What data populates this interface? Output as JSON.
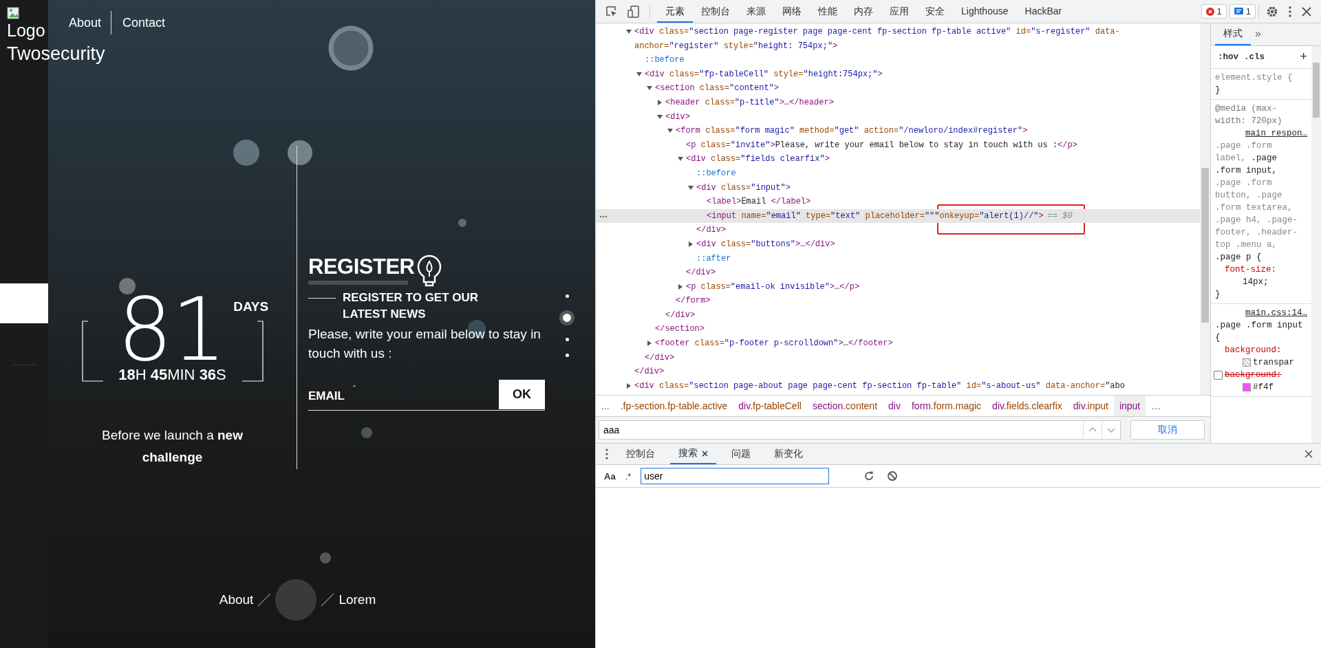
{
  "page": {
    "logo_alt": "Logo",
    "brand": "Twosecurity",
    "nav": [
      {
        "label": "About"
      },
      {
        "label": "Contact"
      }
    ],
    "countdown": {
      "days": "81",
      "days_label": "DAYS",
      "parts": [
        {
          "value": "18",
          "unit": "H"
        },
        {
          "value": "45",
          "unit": "MIN"
        },
        {
          "value": "36",
          "unit": "S"
        }
      ]
    },
    "tagline": "Before we launch a **new challenge**",
    "register": {
      "title": "REGISTER",
      "subtitle": "REGISTER TO GET OUR LATEST NEWS",
      "invite": "Please, write your email below to stay in touch with us :",
      "email_label": "EMAIL",
      "email_value": "\"",
      "button": "OK"
    },
    "section_dots": [
      {
        "selected": false
      },
      {
        "selected": true
      },
      {
        "selected": false
      },
      {
        "selected": false
      }
    ],
    "footer_links": [
      {
        "label": "About"
      },
      {
        "label": "Lorem"
      }
    ]
  },
  "devtools": {
    "tabs": [
      {
        "label": "元素",
        "selected": true
      },
      {
        "label": "控制台",
        "selected": false
      },
      {
        "label": "来源",
        "selected": false
      },
      {
        "label": "网络",
        "selected": false
      },
      {
        "label": "性能",
        "selected": false
      },
      {
        "label": "内存",
        "selected": false
      },
      {
        "label": "应用",
        "selected": false
      },
      {
        "label": "安全",
        "selected": false
      },
      {
        "label": "Lighthouse",
        "selected": false
      },
      {
        "label": "HackBar",
        "selected": false
      }
    ],
    "errors": "1",
    "messages": "1",
    "tree": [
      {
        "kind": "parent",
        "expanded": true,
        "selected": false,
        "text": "<div class=\"section page-register page page-cent fp-section fp-table active\" id=\"s-register\" data-anchor=\"register\" style=\"height: 754px;\">",
        "close": "</div>",
        "children": [
          {
            "kind": "pseudo",
            "selected": false,
            "text": "::before"
          },
          {
            "kind": "parent",
            "expanded": true,
            "selected": false,
            "text": "<div class=\"fp-tableCell\" style=\"height:754px;\">",
            "close": "</div>",
            "children": [
              {
                "kind": "parent",
                "expanded": true,
                "selected": false,
                "text": "<section class=\"content\">",
                "close": "</section>",
                "children": [
                  {
                    "kind": "parent",
                    "expanded": false,
                    "selected": false,
                    "text": "<header class=\"p-title\">…</header>"
                  },
                  {
                    "kind": "parent",
                    "expanded": true,
                    "selected": false,
                    "text": "<div>",
                    "close": "</div>",
                    "children": [
                      {
                        "kind": "parent",
                        "expanded": true,
                        "selected": false,
                        "text": "<form class=\"form magic\" method=\"get\" action=\"/newloro/index#register\">",
                        "close": "</form>",
                        "children": [
                          {
                            "kind": "leaf",
                            "selected": false,
                            "text": "<p class=\"invite\">Please, write your email below to stay in touch with us :</p>"
                          },
                          {
                            "kind": "parent",
                            "expanded": true,
                            "selected": false,
                            "text": "<div class=\"fields clearfix\">",
                            "close": "</div>",
                            "children": [
                              {
                                "kind": "pseudo",
                                "selected": false,
                                "text": "::before"
                              },
                              {
                                "kind": "parent",
                                "expanded": true,
                                "selected": false,
                                "text": "<div class=\"input\">",
                                "close": "</div>",
                                "children": [
                                  {
                                    "kind": "leaf",
                                    "selected": false,
                                    "text": "<label>Email </label>"
                                  },
                                  {
                                    "kind": "leaf",
                                    "selected": true,
                                    "text": "<input name=\"email\" type=\"text\" placeholder=\"\"\"",
                                    "annotation": "onkeyup=\"alert(1)//\">",
                                    "suffix": "== $0"
                                  }
                                ]
                              },
                              {
                                "kind": "parent",
                                "expanded": false,
                                "selected": false,
                                "text": "<div class=\"buttons\">…</div>"
                              },
                              {
                                "kind": "pseudo",
                                "selected": false,
                                "text": "::after"
                              }
                            ]
                          },
                          {
                            "kind": "parent",
                            "expanded": false,
                            "selected": false,
                            "text": "<p class=\"email-ok invisible\">…</p>"
                          }
                        ]
                      }
                    ]
                  }
                ]
              },
              {
                "kind": "parent",
                "expanded": false,
                "selected": false,
                "text": "<footer class=\"p-footer p-scrolldown\">…</footer>"
              }
            ]
          }
        ]
      },
      {
        "kind": "parent",
        "expanded": false,
        "selected": false,
        "text": "<div class=\"section page-about page page-cent fp-section fp-table\" id=\"s-about-us\" data-anchor=\"abo"
      }
    ],
    "breadcrumb_more_left": "...",
    "breadcrumb_more_right": "…",
    "breadcrumb": [
      {
        "label": ".fp-section.fp-table.active",
        "selected": false
      },
      {
        "label": "div.fp-tableCell",
        "selected": false
      },
      {
        "label": "section.content",
        "selected": false
      },
      {
        "label": "div",
        "selected": false
      },
      {
        "label": "form.form.magic",
        "selected": false
      },
      {
        "label": "div.fields.clearfix",
        "selected": false
      },
      {
        "label": "div.input",
        "selected": false
      },
      {
        "label": "input",
        "selected": true
      }
    ],
    "find": {
      "value": "aaa",
      "cancel": "取消"
    },
    "styles": {
      "tabs": [
        {
          "label": "样式",
          "selected": true
        }
      ],
      "more": "»",
      "hov": ":hov",
      "cls": ".cls",
      "add": "+",
      "rules": [
        {
          "selector": [
            {
              "text": "element.style {",
              "matched": false
            }
          ],
          "close": "}"
        },
        {
          "media": "@media (max-width: 720px)",
          "source": "main_respon…",
          "selector": [
            {
              "text": ".page .form label, ",
              "matched": false
            },
            {
              "text": ".page .form input,",
              "matched": true
            },
            {
              "text": " .page .form button, .page .form textarea, .page h4, .page-footer, .header-top .menu a, ",
              "matched": false
            },
            {
              "text": ".page p {",
              "matched": true
            }
          ],
          "properties": [
            {
              "name": "font-size:",
              "value": "14px;",
              "overridden": false
            }
          ],
          "close": "}"
        },
        {
          "source": "main.css:14…",
          "selector": [
            {
              "text": ".page .form input {",
              "matched": true
            }
          ],
          "properties": [
            {
              "name": "background:",
              "value": "transpar",
              "overridden": false,
              "transparent_swatch": true
            },
            {
              "name": "background:",
              "value": "#f4f",
              "overridden": true,
              "checked": false,
              "color": "#ff4dff"
            }
          ]
        }
      ]
    },
    "drawer": {
      "tabs": [
        {
          "label": "控制台",
          "selected": false,
          "closable": false
        },
        {
          "label": "搜索",
          "selected": true,
          "closable": true
        },
        {
          "label": "问题",
          "selected": false,
          "closable": false
        },
        {
          "label": "新变化",
          "selected": false,
          "closable": false
        }
      ],
      "case_toggle": "Aa",
      "regex_toggle": ".*",
      "search_value": "user"
    }
  }
}
